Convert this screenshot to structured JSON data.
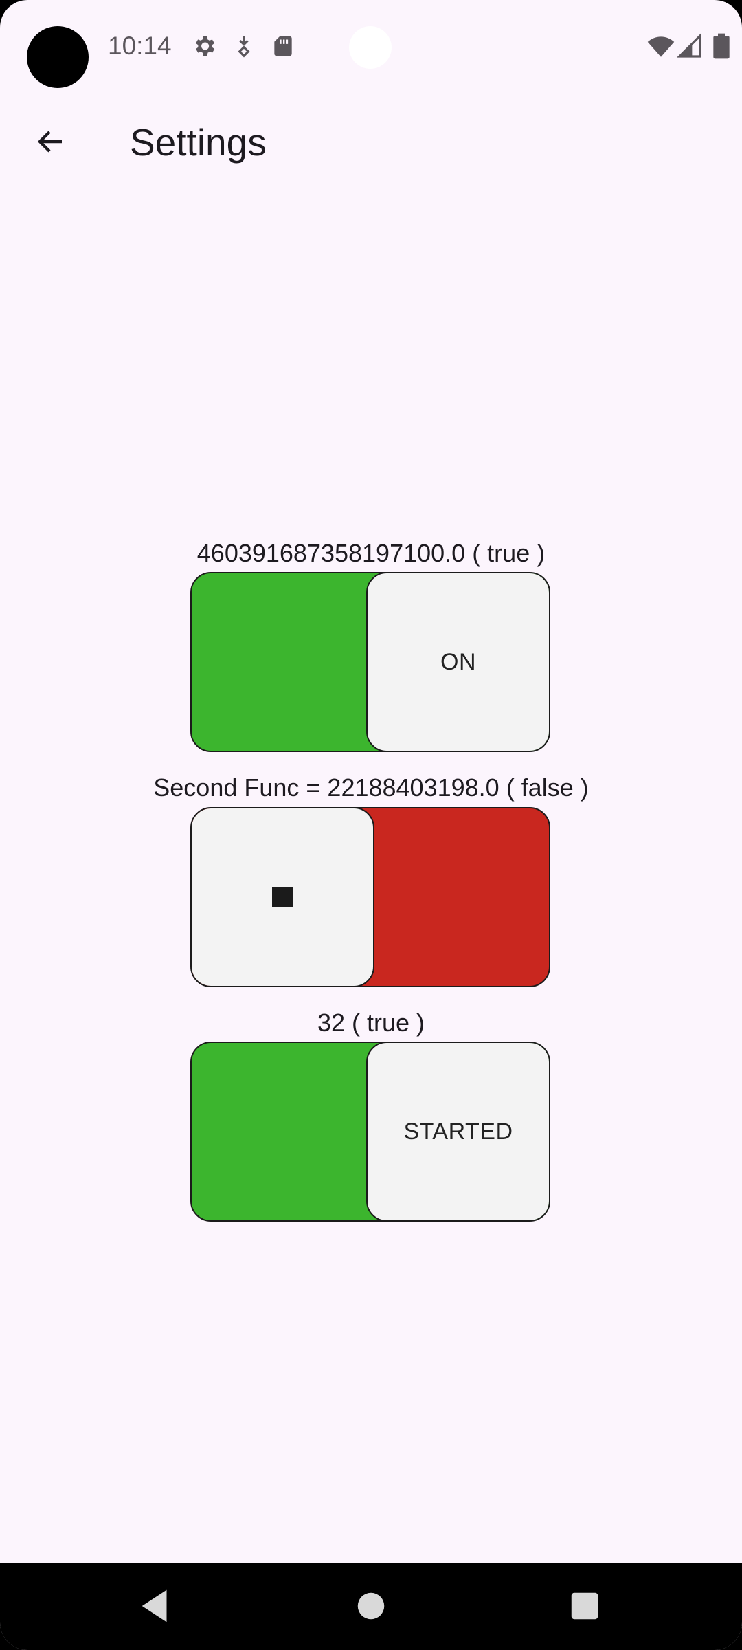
{
  "status_bar": {
    "time": "10:14",
    "left_icons": [
      "gear-icon",
      "download-arrow-icon",
      "sd-card-icon"
    ],
    "right_icons": [
      "wifi-icon",
      "cell-signal-icon",
      "battery-icon"
    ]
  },
  "app_bar": {
    "back_icon": "arrow-back-icon",
    "title": "Settings"
  },
  "switches": [
    {
      "label": "460391687358197100.0 ( true )",
      "state": "on",
      "thumb_text": "ON",
      "track_color": "#3cb52e"
    },
    {
      "label": "Second Func = 22188403198.0 ( false )",
      "state": "off",
      "thumb_icon": "stop-square-icon",
      "track_color": "#c9271f"
    },
    {
      "label": "32 ( true )",
      "state": "on",
      "thumb_text": "STARTED",
      "track_color": "#3cb52e"
    }
  ],
  "nav_bar": {
    "buttons": [
      "back-triangle-icon",
      "home-circle-icon",
      "recents-square-icon"
    ]
  },
  "colors": {
    "background": "#fcf5fd",
    "on_track": "#3cb52e",
    "off_track": "#c9271f",
    "thumb": "#f3f3f3"
  }
}
